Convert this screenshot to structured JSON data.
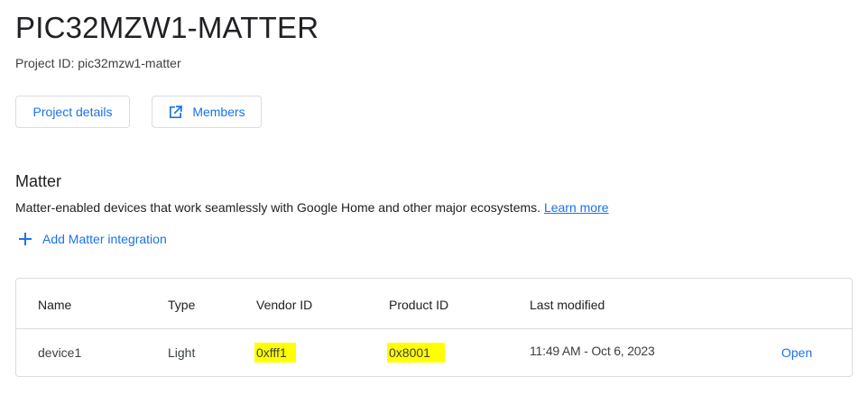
{
  "project": {
    "title": "PIC32MZW1-MATTER",
    "project_id_label": "Project ID: pic32mzw1-matter"
  },
  "actions": {
    "project_details_label": "Project details",
    "members_label": "Members"
  },
  "matter": {
    "heading": "Matter",
    "description": "Matter-enabled devices that work seamlessly with Google Home and other major ecosystems.",
    "learn_more_label": "Learn more",
    "add_integration_label": "Add Matter integration"
  },
  "table": {
    "columns": [
      "Name",
      "Type",
      "Vendor ID",
      "Product ID",
      "Last modified"
    ],
    "rows": [
      {
        "name": "device1",
        "type": "Light",
        "vendor_id": "0xfff1",
        "product_id": "0x8001",
        "last_modified": "11:49 AM - Oct 6, 2023",
        "open_label": "Open"
      }
    ]
  },
  "colors": {
    "accent": "#1a73e8",
    "border": "#dadce0",
    "highlight": "#ffff00",
    "text": "#202124"
  },
  "icons": {
    "members": "open-in-new-icon",
    "add": "plus-icon"
  }
}
